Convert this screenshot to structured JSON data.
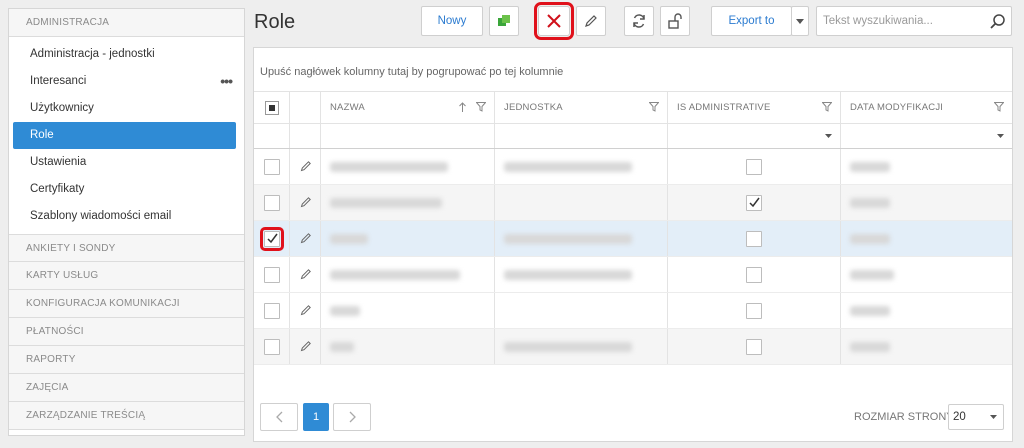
{
  "sidebar": {
    "sections": [
      {
        "title": "ADMINISTRACJA",
        "open": true,
        "items": [
          {
            "label": "Administracja - jednostki"
          },
          {
            "label": "Interesanci",
            "menu": "•••"
          },
          {
            "label": "Użytkownicy"
          },
          {
            "label": "Role",
            "active": true
          },
          {
            "label": "Ustawienia"
          },
          {
            "label": "Certyfikaty"
          },
          {
            "label": "Szablony wiadomości email"
          }
        ]
      },
      {
        "title": "ANKIETY I SONDY"
      },
      {
        "title": "KARTY USŁUG"
      },
      {
        "title": "KONFIGURACJA KOMUNIKACJI"
      },
      {
        "title": "PŁATNOŚCI"
      },
      {
        "title": "RAPORTY"
      },
      {
        "title": "ZAJĘCIA"
      },
      {
        "title": "ZARZĄDZANIE TREŚCIĄ"
      }
    ]
  },
  "toolbar": {
    "page_title": "Role",
    "new_label": "Nowy",
    "export_label": "Export to",
    "search_placeholder": "Tekst wyszukiwania..."
  },
  "grid": {
    "group_panel_text": "Upuść nagłówek kolumny tutaj by pogrupować po tej kolumnie",
    "columns": [
      "NAZWA",
      "JEDNOSTKA",
      "IS ADMINISTRATIVE",
      "DATA MODYFIKACJI"
    ],
    "rows": [
      {
        "selected": false,
        "is_admin": false
      },
      {
        "selected": false,
        "is_admin": true
      },
      {
        "selected": true,
        "is_admin": false
      },
      {
        "selected": false,
        "is_admin": false
      },
      {
        "selected": false,
        "is_admin": false
      },
      {
        "selected": false,
        "is_admin": false
      }
    ]
  },
  "pager": {
    "current_page": "1",
    "page_size_label": "ROZMIAR STRONY",
    "page_size": "20"
  },
  "colors": {
    "accent": "#2f8bd5",
    "highlight": "#e0111b",
    "selected_row": "#e3eef8"
  }
}
